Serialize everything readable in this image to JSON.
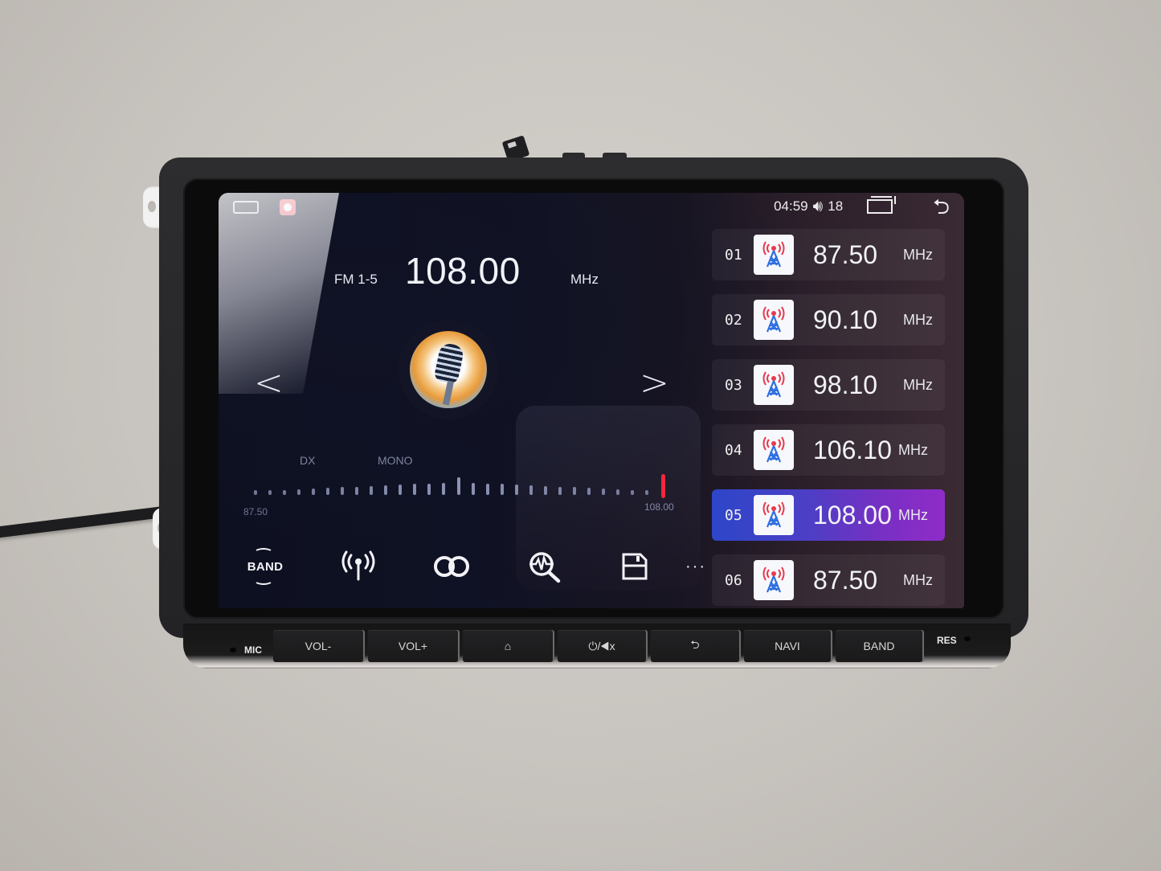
{
  "status_bar": {
    "time": "04:59",
    "volume_icon": "speaker-icon",
    "volume": "18",
    "recent_icon": "recent-apps-icon",
    "back_icon": "back-icon",
    "left_icons": [
      "car-icon",
      "record-icon"
    ]
  },
  "radio": {
    "band": "FM 1-5",
    "frequency": "108.00",
    "unit": "MHz",
    "prev_icon": "chevron-left-icon",
    "next_icon": "chevron-right-icon",
    "prev_glyph": "<",
    "next_glyph": ">",
    "art_icon": "microphone-artwork",
    "flags": {
      "dx": "DX",
      "mono": "MONO"
    },
    "scale": {
      "min": "87.50",
      "max": "108.00",
      "min_value": 87.5,
      "max_value": 108.0,
      "current_value": 108.0,
      "tick_count": 28
    }
  },
  "toolbar": [
    {
      "name": "band",
      "icon": "band-icon",
      "label": "BAND"
    },
    {
      "name": "antenna",
      "icon": "antenna-icon",
      "glyph": "((•))"
    },
    {
      "name": "stereo",
      "icon": "stereo-loop-icon",
      "glyph": "OO"
    },
    {
      "name": "scan",
      "icon": "scan-search-icon",
      "glyph": "⌕"
    },
    {
      "name": "save",
      "icon": "save-icon",
      "glyph": "🖫"
    },
    {
      "name": "more",
      "icon": "more-dots-icon",
      "glyph": "···"
    }
  ],
  "presets": [
    {
      "index": "01",
      "frequency": "87.50",
      "unit": "MHz",
      "active": false
    },
    {
      "index": "02",
      "frequency": "90.10",
      "unit": "MHz",
      "active": false
    },
    {
      "index": "03",
      "frequency": "98.10",
      "unit": "MHz",
      "active": false
    },
    {
      "index": "04",
      "frequency": "106.10",
      "unit": "MHz",
      "active": false
    },
    {
      "index": "05",
      "frequency": "108.00",
      "unit": "MHz",
      "active": true
    },
    {
      "index": "06",
      "frequency": "87.50",
      "unit": "MHz",
      "active": false
    }
  ],
  "colors": {
    "active_gradient_start": "#2d46c9",
    "active_gradient_end": "#8f2cc8",
    "needle": "#f0283c",
    "tower_red": "#e63a4e",
    "tower_blue": "#2f6fe0"
  },
  "hardware_buttons": {
    "mic": "MIC",
    "vol_down": "VOL-",
    "vol_up": "VOL+",
    "home": "⌂",
    "power_mute": "⏻/◀x",
    "back": "⮌",
    "navi": "NAVI",
    "band": "BAND",
    "res": "RES"
  }
}
